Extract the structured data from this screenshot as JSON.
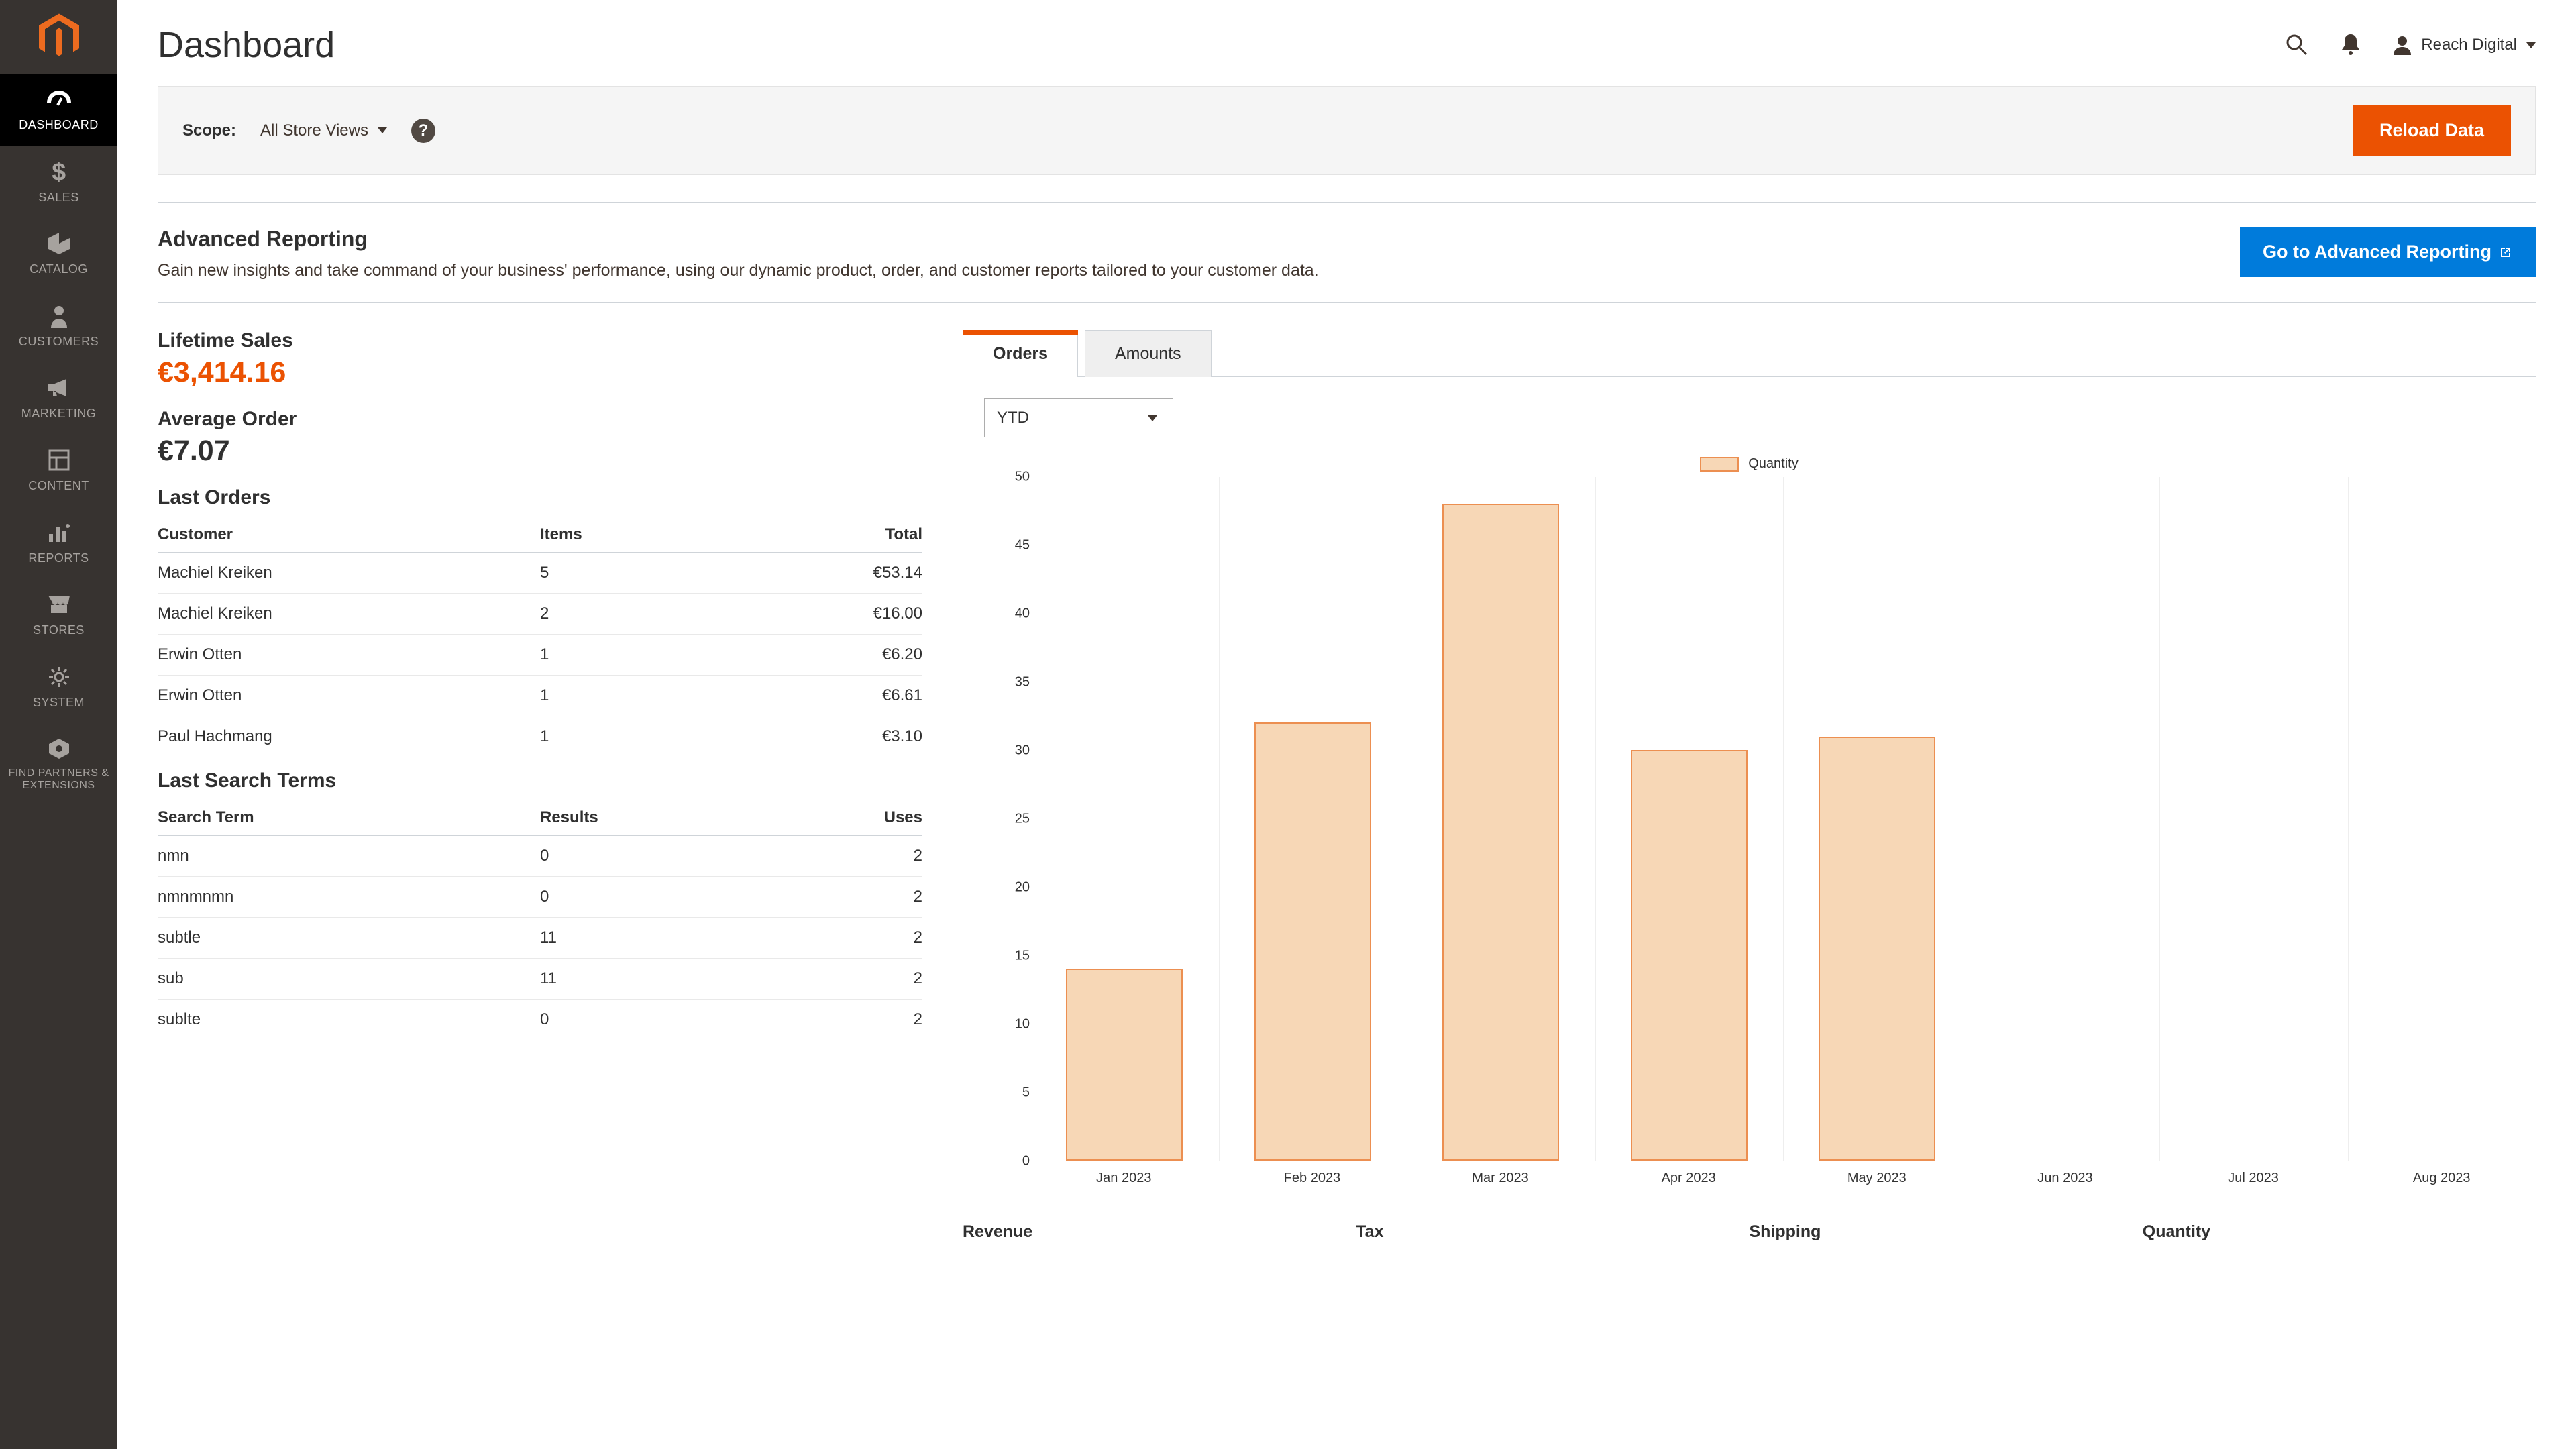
{
  "sidebar": {
    "items": [
      {
        "label": "DASHBOARD"
      },
      {
        "label": "SALES"
      },
      {
        "label": "CATALOG"
      },
      {
        "label": "CUSTOMERS"
      },
      {
        "label": "MARKETING"
      },
      {
        "label": "CONTENT"
      },
      {
        "label": "REPORTS"
      },
      {
        "label": "STORES"
      },
      {
        "label": "SYSTEM"
      },
      {
        "label": "FIND PARTNERS & EXTENSIONS"
      }
    ]
  },
  "header": {
    "title": "Dashboard",
    "account_name": "Reach Digital"
  },
  "scope": {
    "label": "Scope:",
    "selected": "All Store Views",
    "reload_label": "Reload Data"
  },
  "advanced": {
    "title": "Advanced Reporting",
    "desc": "Gain new insights and take command of your business' performance, using our dynamic product, order, and customer reports tailored to your customer data.",
    "button": "Go to Advanced Reporting"
  },
  "metrics": {
    "lifetime_label": "Lifetime Sales",
    "lifetime_value": "€3,414.16",
    "avg_label": "Average Order",
    "avg_value": "€7.07"
  },
  "last_orders": {
    "title": "Last Orders",
    "cols": {
      "c0": "Customer",
      "c1": "Items",
      "c2": "Total"
    },
    "rows": [
      {
        "c0": "Machiel Kreiken",
        "c1": "5",
        "c2": "€53.14"
      },
      {
        "c0": "Machiel Kreiken",
        "c1": "2",
        "c2": "€16.00"
      },
      {
        "c0": "Erwin Otten",
        "c1": "1",
        "c2": "€6.20"
      },
      {
        "c0": "Erwin Otten",
        "c1": "1",
        "c2": "€6.61"
      },
      {
        "c0": "Paul Hachmang",
        "c1": "1",
        "c2": "€3.10"
      }
    ]
  },
  "last_search": {
    "title": "Last Search Terms",
    "cols": {
      "c0": "Search Term",
      "c1": "Results",
      "c2": "Uses"
    },
    "rows": [
      {
        "c0": "nmn",
        "c1": "0",
        "c2": "2"
      },
      {
        "c0": "nmnmnmn",
        "c1": "0",
        "c2": "2"
      },
      {
        "c0": "subtle",
        "c1": "11",
        "c2": "2"
      },
      {
        "c0": "sub",
        "c1": "11",
        "c2": "2"
      },
      {
        "c0": "sublte",
        "c1": "0",
        "c2": "2"
      }
    ]
  },
  "tabs": {
    "orders": "Orders",
    "amounts": "Amounts"
  },
  "range": {
    "selected": "YTD"
  },
  "chart_legend": "Quantity",
  "chart_data": {
    "type": "bar",
    "title": "",
    "xlabel": "",
    "ylabel": "",
    "ylim": [
      0,
      50
    ],
    "yticks": [
      0,
      5,
      10,
      15,
      20,
      25,
      30,
      35,
      40,
      45,
      50
    ],
    "categories": [
      "Jan 2023",
      "Feb 2023",
      "Mar 2023",
      "Apr 2023",
      "May 2023",
      "Jun 2023",
      "Jul 2023",
      "Aug 2023"
    ],
    "series": [
      {
        "name": "Quantity",
        "values": [
          14,
          32,
          48,
          30,
          31,
          0,
          0,
          0
        ]
      }
    ]
  },
  "summary": {
    "revenue": "Revenue",
    "tax": "Tax",
    "shipping": "Shipping",
    "quantity": "Quantity"
  }
}
